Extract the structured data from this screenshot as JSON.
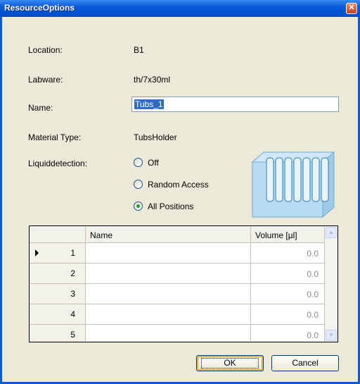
{
  "window": {
    "title": "ResourceOptions"
  },
  "fields": {
    "location": {
      "label": "Location:",
      "value": "B1"
    },
    "labware": {
      "label": "Labware:",
      "value": "th/7x30ml"
    },
    "name": {
      "label": "Name:",
      "value": "Tubs_1"
    },
    "material_type": {
      "label": "Material Type:",
      "value": "TubsHolder"
    },
    "liquiddetection": {
      "label": "Liquiddetection:",
      "options": [
        "Off",
        "Random Access",
        "All Positions"
      ],
      "selected": "All Positions"
    }
  },
  "table": {
    "columns": [
      "Name",
      "Volume [µl]"
    ],
    "rows": [
      {
        "num": "1",
        "name": "",
        "volume": "0.0"
      },
      {
        "num": "2",
        "name": "",
        "volume": "0.0"
      },
      {
        "num": "3",
        "name": "",
        "volume": "0.0"
      },
      {
        "num": "4",
        "name": "",
        "volume": "0.0"
      },
      {
        "num": "5",
        "name": "",
        "volume": "0.0"
      }
    ]
  },
  "buttons": {
    "ok": "OK",
    "cancel": "Cancel"
  },
  "icons": {
    "close": "close-icon",
    "tubs": "tubs-holder-icon",
    "scroll_up": "arrow-up-icon",
    "scroll_down": "arrow-down-icon",
    "row_pointer": "row-pointer-icon"
  },
  "colors": {
    "title_bar": "#0a5ad8",
    "client_bg": "#ece9d8",
    "selection": "#316ac5",
    "radio_dot": "#21a121"
  }
}
